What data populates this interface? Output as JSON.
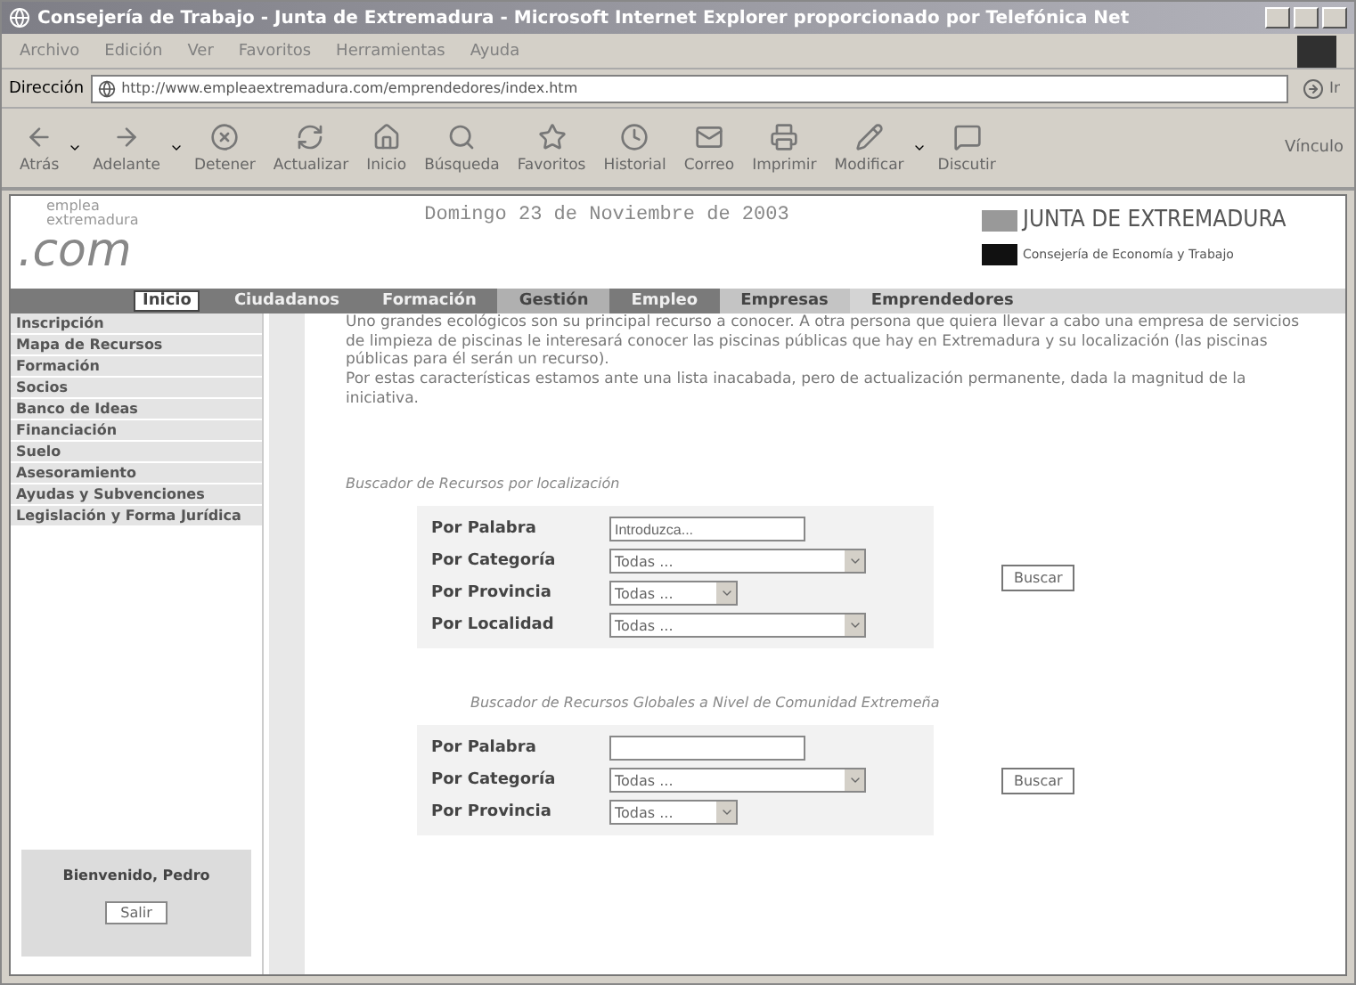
{
  "window": {
    "title": "Consejería de Trabajo - Junta de Extremadura - Microsoft Internet Explorer proporcionado por Telefónica Net"
  },
  "menu_bar": [
    "Archivo",
    "Edición",
    "Ver",
    "Favoritos",
    "Herramientas",
    "Ayuda"
  ],
  "address_bar": {
    "label": "Dirección",
    "url": "http://www.empleaextremadura.com/emprendedores/index.htm",
    "go": "Ir"
  },
  "toolbar": [
    {
      "label": "Atrás",
      "dropdown": true
    },
    {
      "label": "Adelante",
      "dropdown": true
    },
    {
      "label": "Detener",
      "dropdown": false
    },
    {
      "label": "Actualizar",
      "dropdown": false
    },
    {
      "label": "Inicio",
      "dropdown": false
    },
    {
      "label": "Búsqueda",
      "dropdown": false
    },
    {
      "label": "Favoritos",
      "dropdown": false
    },
    {
      "label": "Historial",
      "dropdown": false
    },
    {
      "label": "Correo",
      "dropdown": false
    },
    {
      "label": "Imprimir",
      "dropdown": false
    },
    {
      "label": "Modificar",
      "dropdown": true
    },
    {
      "label": "Discutir",
      "dropdown": false
    }
  ],
  "links_label": "Vínculo",
  "page": {
    "logo": {
      "top": "emplea",
      "middle": "extremadura",
      "bottom": ".com"
    },
    "date": "Domingo 23 de Noviembre de 2003",
    "junta": "JUNTA DE EXTREMADURA",
    "consejeria": "Consejería de Economía y Trabajo",
    "nav": [
      {
        "label": "Inicio",
        "selected": true,
        "color": "#ffffff"
      },
      {
        "label": "Ciudadanos",
        "selected": false,
        "color": "#7a7a7a"
      },
      {
        "label": "Formación",
        "selected": false,
        "color": "#7a7a7a"
      },
      {
        "label": "Gestión",
        "selected": false,
        "color": "#b0b0b0"
      },
      {
        "label": "Empleo",
        "selected": false,
        "color": "#7a7a7a"
      },
      {
        "label": "Empresas",
        "selected": false,
        "color": "#c4c4c4"
      },
      {
        "label": "Emprendedores",
        "selected": false,
        "color": "#d4d4d4"
      }
    ],
    "sidebar": [
      "Inscripción",
      "Mapa de Recursos",
      "Formación",
      "Socios",
      "Banco de Ideas",
      "Financiación",
      "Suelo",
      "Asesoramiento",
      "Ayudas y Subvenciones",
      "Legislación y Forma Jurídica"
    ],
    "intro": [
      "Uno grandes ecológicos son su principal recurso a conocer. A otra persona que quiera llevar a cabo una empresa de servicios de limpieza de piscinas le interesará conocer las piscinas públicas que hay en Extremadura y su localización (las piscinas públicas para él serán un recurso).",
      "Por estas características estamos ante una lista inacabada, pero de actualización permanente, dada la magnitud de la iniciativa."
    ],
    "searches": [
      {
        "title": "Buscador de Recursos por localización",
        "button": "Buscar",
        "fields": [
          {
            "label": "Por Palabra",
            "kind": "text",
            "value": "Introduzca..."
          },
          {
            "label": "Por Categoría",
            "kind": "select",
            "value": "Todas ..."
          },
          {
            "label": "Por Provincia",
            "kind": "short-select",
            "value": "Todas ..."
          },
          {
            "label": "Por Localidad",
            "kind": "select",
            "value": "Todas ..."
          }
        ]
      },
      {
        "title": "Buscador de Recursos Globales a Nivel de Comunidad Extremeña",
        "button": "Buscar",
        "fields": [
          {
            "label": "Por Palabra",
            "kind": "text"
          },
          {
            "label": "Por Categoría",
            "kind": "select",
            "value": "Todas ..."
          },
          {
            "label": "Por Provincia",
            "kind": "short-select",
            "value": "Todas ..."
          }
        ]
      }
    ],
    "welcome": {
      "text": "Bienvenido, Pedro",
      "button": "Salir"
    }
  }
}
